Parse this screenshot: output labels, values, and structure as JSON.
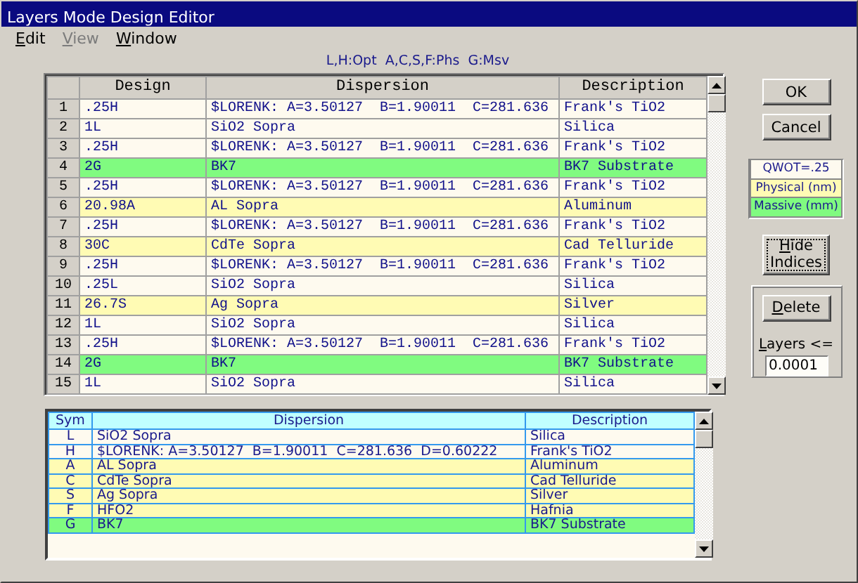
{
  "window": {
    "title": "Layers Mode Design Editor"
  },
  "menu": [
    {
      "label": "Edit",
      "disabled": false
    },
    {
      "label": "View",
      "disabled": true
    },
    {
      "label": "Window",
      "disabled": false
    }
  ],
  "legend": "L,H:Opt  A,C,S,F:Phs  G:Msv",
  "design_table": {
    "columns": [
      "Design",
      "Dispersion",
      "Description"
    ],
    "rows": [
      {
        "index": "1",
        "design": ".25H",
        "dispersion": "$LORENK: A=3.50127  B=1.90011  C=281.636",
        "description": "Frank's TiO2",
        "kind": "optical"
      },
      {
        "index": "2",
        "design": "1L",
        "dispersion": "SiO2 Sopra",
        "description": "Silica",
        "kind": "optical"
      },
      {
        "index": "3",
        "design": ".25H",
        "dispersion": "$LORENK: A=3.50127  B=1.90011  C=281.636",
        "description": "Frank's TiO2",
        "kind": "optical"
      },
      {
        "index": "4",
        "design": "2G",
        "dispersion": "BK7",
        "description": "BK7 Substrate",
        "kind": "massive"
      },
      {
        "index": "5",
        "design": ".25H",
        "dispersion": "$LORENK: A=3.50127  B=1.90011  C=281.636",
        "description": "Frank's TiO2",
        "kind": "optical"
      },
      {
        "index": "6",
        "design": "20.98A",
        "dispersion": "AL Sopra",
        "description": "Aluminum",
        "kind": "physical"
      },
      {
        "index": "7",
        "design": ".25H",
        "dispersion": "$LORENK: A=3.50127  B=1.90011  C=281.636",
        "description": "Frank's TiO2",
        "kind": "optical"
      },
      {
        "index": "8",
        "design": "30C",
        "dispersion": "CdTe Sopra",
        "description": "Cad Telluride",
        "kind": "physical"
      },
      {
        "index": "9",
        "design": ".25H",
        "dispersion": "$LORENK: A=3.50127  B=1.90011  C=281.636",
        "description": "Frank's TiO2",
        "kind": "optical"
      },
      {
        "index": "10",
        "design": ".25L",
        "dispersion": "SiO2 Sopra",
        "description": "Silica",
        "kind": "optical"
      },
      {
        "index": "11",
        "design": "26.7S",
        "dispersion": "Ag Sopra",
        "description": "Silver",
        "kind": "physical"
      },
      {
        "index": "12",
        "design": "1L",
        "dispersion": "SiO2 Sopra",
        "description": "Silica",
        "kind": "optical"
      },
      {
        "index": "13",
        "design": ".25H",
        "dispersion": "$LORENK: A=3.50127  B=1.90011  C=281.636",
        "description": "Frank's TiO2",
        "kind": "optical"
      },
      {
        "index": "14",
        "design": "2G",
        "dispersion": "BK7",
        "description": "BK7 Substrate",
        "kind": "massive"
      },
      {
        "index": "15",
        "design": "1L",
        "dispersion": "SiO2 Sopra",
        "description": "Silica",
        "kind": "optical"
      }
    ]
  },
  "symbol_table": {
    "columns": [
      "Sym",
      "Dispersion",
      "Description"
    ],
    "rows": [
      {
        "sym": "L",
        "dispersion": "SiO2 Sopra",
        "description": "Silica",
        "kind": "optical"
      },
      {
        "sym": "H",
        "dispersion": "$LORENK: A=3.50127  B=1.90011  C=281.636  D=0.60222",
        "description": "Frank's TiO2",
        "kind": "optical"
      },
      {
        "sym": "A",
        "dispersion": "AL Sopra",
        "description": "Aluminum",
        "kind": "physical"
      },
      {
        "sym": "C",
        "dispersion": "CdTe Sopra",
        "description": "Cad Telluride",
        "kind": "physical"
      },
      {
        "sym": "S",
        "dispersion": "Ag Sopra",
        "description": "Silver",
        "kind": "physical"
      },
      {
        "sym": "F",
        "dispersion": "HFO2",
        "description": "Hafnia",
        "kind": "physical"
      },
      {
        "sym": "G",
        "dispersion": "BK7",
        "description": "BK7 Substrate",
        "kind": "massive"
      }
    ]
  },
  "buttons": [
    {
      "label": "OK"
    },
    {
      "label": "Cancel"
    }
  ],
  "thickness_legend": [
    {
      "label": "QWOT=.25",
      "kind": "optical"
    },
    {
      "label": "Physical (nm)",
      "kind": "physical"
    },
    {
      "label": "Massive (mm)",
      "kind": "massive"
    }
  ],
  "hide_indices_button": {
    "label": "Hide Indices"
  },
  "delete_group": {
    "button": "Delete",
    "label": "Layers <=",
    "value": "0.0001"
  }
}
